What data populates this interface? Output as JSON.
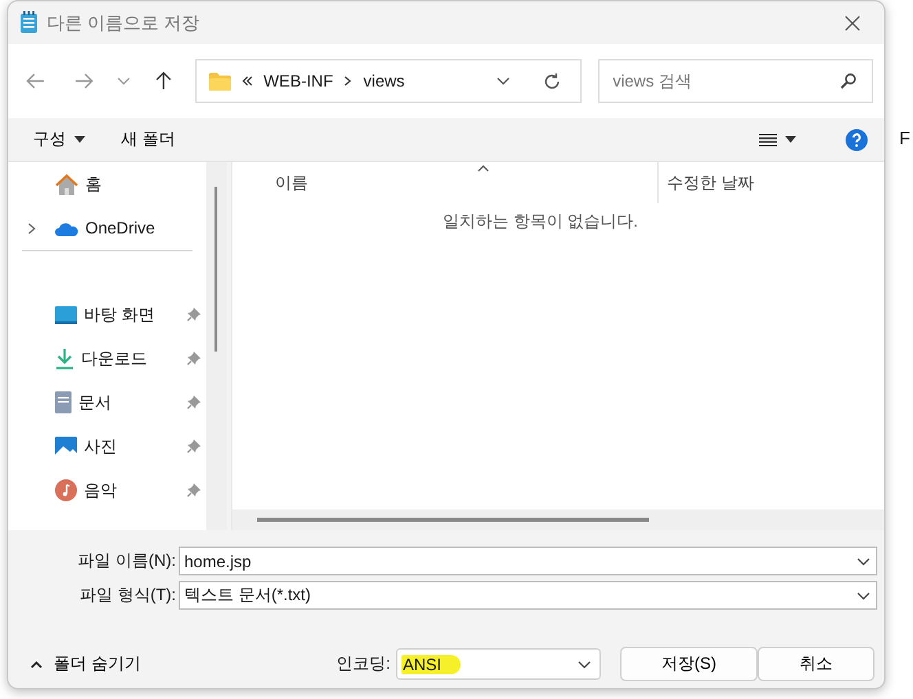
{
  "window": {
    "title": "다른 이름으로 저장"
  },
  "address": {
    "path": [
      "WEB-INF",
      "views"
    ]
  },
  "search": {
    "placeholder": "views 검색"
  },
  "toolbar": {
    "organize": "구성",
    "new_folder": "새 폴더"
  },
  "background_text": "F",
  "sidebar": {
    "sections": [
      {
        "items": [
          {
            "label": "홈",
            "kind": "home",
            "expandable": false,
            "pinned": false
          },
          {
            "label": "OneDrive",
            "kind": "cloud",
            "expandable": true,
            "pinned": false
          }
        ]
      },
      {
        "items": [
          {
            "label": "바탕 화면",
            "kind": "desktop",
            "expandable": false,
            "pinned": true
          },
          {
            "label": "다운로드",
            "kind": "download",
            "expandable": false,
            "pinned": true
          },
          {
            "label": "문서",
            "kind": "document",
            "expandable": false,
            "pinned": true
          },
          {
            "label": "사진",
            "kind": "picture",
            "expandable": false,
            "pinned": true
          },
          {
            "label": "음악",
            "kind": "music",
            "expandable": false,
            "pinned": true
          }
        ]
      }
    ]
  },
  "file_list": {
    "columns": [
      {
        "label": "이름",
        "sorted": true
      },
      {
        "label": "수정한 날짜",
        "sorted": false
      }
    ],
    "empty_message": "일치하는 항목이 없습니다."
  },
  "fields": [
    {
      "label": "파일 이름(N):",
      "value": "home.jsp"
    },
    {
      "label": "파일 형식(T):",
      "value": "텍스트 문서(*.txt)"
    }
  ],
  "footer": {
    "toggle": "폴더 숨기기",
    "encoding_label": "인코딩:",
    "encoding": "ANSI",
    "highlighted": true,
    "buttons": [
      "저장(S)",
      "취소"
    ]
  }
}
